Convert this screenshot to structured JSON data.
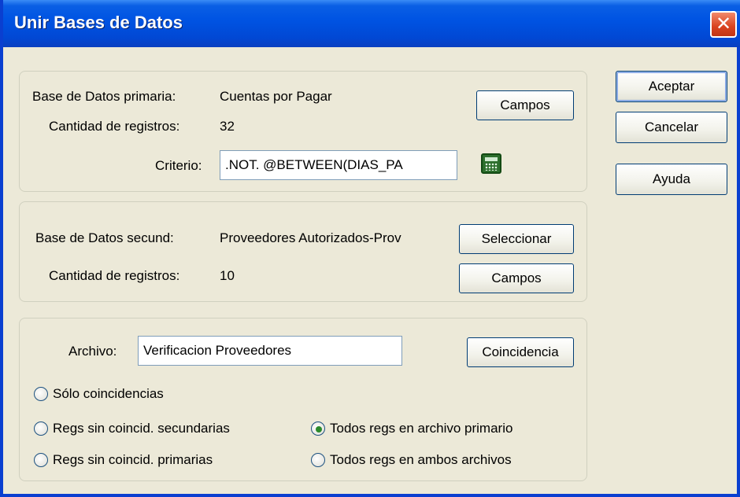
{
  "window": {
    "title": "Unir Bases de Datos",
    "close_glyph": "✕"
  },
  "primary": {
    "db_label": "Base de Datos primaria:",
    "db_value": "Cuentas por Pagar",
    "count_label": "Cantidad de registros:",
    "count_value": "32",
    "criteria_label": "Criterio:",
    "criteria_value": ".NOT. @BETWEEN(DIAS_PA",
    "fields_button": "Campos",
    "calculator_icon": "calculator-icon"
  },
  "secondary": {
    "db_label": "Base de Datos secund:",
    "db_value": "Proveedores Autorizados-Prov",
    "count_label": "Cantidad de registros:",
    "count_value": "10",
    "select_button": "Seleccionar",
    "fields_button": "Campos"
  },
  "output": {
    "file_label": "Archivo:",
    "file_value": "Verificacion Proveedores",
    "match_button": "Coincidencia",
    "options": {
      "only_matches": "Sólo coincidencias",
      "unmatched_secondary": "Regs sin coincid. secundarias",
      "unmatched_primary": "Regs sin coincid. primarias",
      "all_primary": "Todos regs en archivo primario",
      "all_both": "Todos regs en ambos archivos"
    },
    "selected": "all_primary"
  },
  "actions": {
    "ok": "Aceptar",
    "cancel": "Cancelar",
    "help": "Ayuda"
  }
}
